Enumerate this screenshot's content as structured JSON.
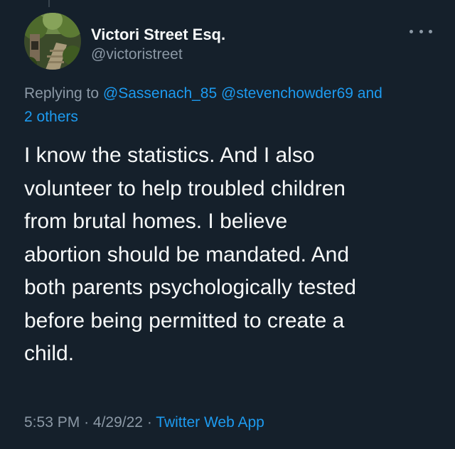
{
  "author": {
    "display_name": "Victori Street Esq.",
    "handle": "@victoristreet",
    "avatar_icon": "forest-path-avatar"
  },
  "replying_to": {
    "prefix": "Replying to",
    "users": [
      "@Sassenach_85",
      "@stevenchowder69"
    ],
    "connector": "and",
    "others": "2 others"
  },
  "tweet": {
    "lines": [
      "I know the statistics. And I also",
      "volunteer to help troubled children",
      "from brutal homes. I believe",
      "abortion should be mandated. And",
      "both parents psychologically tested",
      "before being permitted to create a",
      "child."
    ]
  },
  "meta": {
    "time": "5:53 PM",
    "separator": "·",
    "date": "4/29/22",
    "source": "Twitter Web App"
  },
  "colors": {
    "background": "#15202b",
    "text": "#f7f9f9",
    "secondary": "#8b98a5",
    "accent": "#1d9bf0"
  }
}
